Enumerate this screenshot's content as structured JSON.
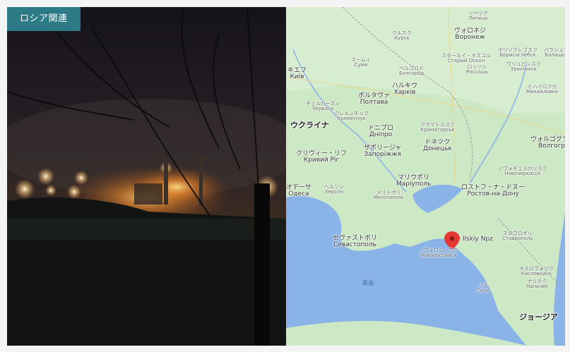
{
  "badge": {
    "label": "ロシア関連"
  },
  "map": {
    "marker_label": "Ilskiy Npz",
    "sea_label": "黒海",
    "places": [
      {
        "ja": "リペツク",
        "local": "Липецк",
        "size": "sm"
      },
      {
        "ja": "ヴォロネジ",
        "local": "Воронеж",
        "size": "md"
      },
      {
        "ja": "クルスク",
        "local": "Курск",
        "size": "sm"
      },
      {
        "ja": "ボリソグレブスク",
        "local": "Борисоглебск",
        "size": "sm"
      },
      {
        "ja": "バラショフ",
        "local": "Балашов",
        "size": "sm"
      },
      {
        "ja": "スームィ",
        "local": "Суми",
        "size": "sm"
      },
      {
        "ja": "ベルゴロド",
        "local": "Белгород",
        "size": "sm"
      },
      {
        "ja": "スタールイ・オスコル",
        "local": "Старый Оскол",
        "size": "sm"
      },
      {
        "ja": "ロッソシ",
        "local": "Россошь",
        "size": "sm"
      },
      {
        "ja": "ウリュピンスク",
        "local": "Урюпинск",
        "size": "sm"
      },
      {
        "ja": "ミハイロフカ",
        "local": "Михайловка",
        "size": "sm"
      },
      {
        "ja": "キエフ",
        "local": "Київ",
        "size": "md"
      },
      {
        "ja": "ハルキウ",
        "local": "Харків",
        "size": "md"
      },
      {
        "ja": "ポルタヴァ",
        "local": "Полтава",
        "size": "md"
      },
      {
        "ja": "チェルカースィ",
        "local": "Черкаси",
        "size": "sm"
      },
      {
        "ja": "クレメンチュク",
        "local": "Кременчук",
        "size": "sm"
      },
      {
        "ja": "ウクライナ",
        "local": "",
        "size": "lg"
      },
      {
        "ja": "ドニプロ",
        "local": "Дніпро",
        "size": "md"
      },
      {
        "ja": "クラマトルスク",
        "local": "Краматорськ",
        "size": "sm"
      },
      {
        "ja": "ドネツク",
        "local": "Донецьк",
        "size": "md"
      },
      {
        "ja": "ザポリージャ",
        "local": "Запоріжжя",
        "size": "md"
      },
      {
        "ja": "クリヴィー・リフ",
        "local": "Кривий Ріг",
        "size": "md"
      },
      {
        "ja": "マリウポリ",
        "local": "Маріуполь",
        "size": "md"
      },
      {
        "ja": "ロストフ・ナ・ドヌー",
        "local": "Ростов-на-Дону",
        "size": "md"
      },
      {
        "ja": "オデーサ",
        "local": "Одеса",
        "size": "md"
      },
      {
        "ja": "ヘルソン",
        "local": "Херсон",
        "size": "sm"
      },
      {
        "ja": "メリトポリ",
        "local": "Мелітополь",
        "size": "sm"
      },
      {
        "ja": "ノヴォチェルカッスク",
        "local": "Новочеркасск",
        "size": "sm"
      },
      {
        "ja": "セヴァストポリ",
        "local": "Севастополь",
        "size": "md"
      },
      {
        "ja": "ノヴォロシースク",
        "local": "Новороссийск",
        "size": "sm"
      },
      {
        "ja": "スタヴロポリ",
        "local": "Ставрополь",
        "size": "sm"
      },
      {
        "ja": "キスロヴォツク",
        "local": "Кисловодск",
        "size": "sm"
      },
      {
        "ja": "ナリチク",
        "local": "Нальчик",
        "size": "sm"
      },
      {
        "ja": "ソチ",
        "local": "Сочи",
        "size": "sm"
      },
      {
        "ja": "ジョージア",
        "local": "",
        "size": "lg"
      },
      {
        "ja": "ヴォルゴグラード",
        "local": "Волгоград",
        "size": "md"
      }
    ]
  },
  "colors": {
    "badge": "#2b7a86",
    "sea": "#8ab4e8",
    "land": "#cde8c4",
    "marker": "#e53935"
  }
}
